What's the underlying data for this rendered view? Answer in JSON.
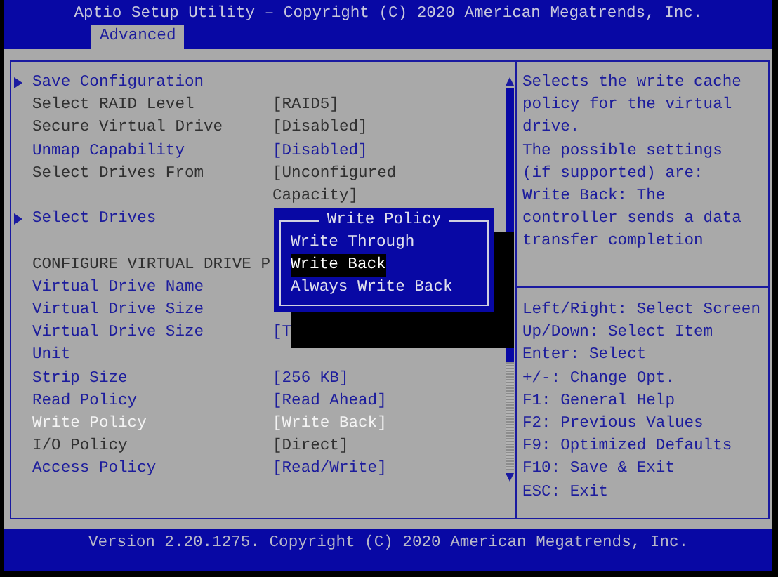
{
  "header": {
    "title": "Aptio Setup Utility – Copyright (C) 2020 American Megatrends, Inc.",
    "tabs": [
      {
        "label": "Advanced",
        "selected": true
      }
    ]
  },
  "settings": [
    {
      "kind": "submenu",
      "label": "Save Configuration",
      "selectable": true,
      "selected": false
    },
    {
      "kind": "setting",
      "label": "Select RAID Level",
      "value": "[RAID5]",
      "selectable": false,
      "selected": false
    },
    {
      "kind": "setting",
      "label": "Secure Virtual Drive",
      "value": "[Disabled]",
      "selectable": false,
      "selected": false
    },
    {
      "kind": "setting",
      "label": "Unmap Capability",
      "value": "[Disabled]",
      "selectable": true,
      "selected": false
    },
    {
      "kind": "setting",
      "label": "Select Drives From",
      "value": "[Unconfigured Capacity]",
      "selectable": false,
      "selected": false
    },
    {
      "kind": "submenu",
      "label": "Select Drives",
      "selectable": true,
      "selected": false
    },
    {
      "kind": "heading",
      "label": "CONFIGURE VIRTUAL DRIVE P"
    },
    {
      "kind": "setting",
      "label": "Virtual Drive Name",
      "selectable": true,
      "selected": false
    },
    {
      "kind": "setting",
      "label": "Virtual Drive Size",
      "selectable": true,
      "selected": false
    },
    {
      "kind": "setting",
      "label": "Virtual Drive Size Unit",
      "value": "[T",
      "selectable": true,
      "selected": false
    },
    {
      "kind": "setting",
      "label": "Strip Size",
      "value": "[256 KB]",
      "selectable": true,
      "selected": false
    },
    {
      "kind": "setting",
      "label": "Read Policy",
      "value": "[Read Ahead]",
      "selectable": true,
      "selected": false
    },
    {
      "kind": "setting",
      "label": "Write Policy",
      "value": "[Write Back]",
      "selectable": true,
      "selected": true
    },
    {
      "kind": "setting",
      "label": "I/O Policy",
      "value": "[Direct]",
      "selectable": false,
      "selected": false
    },
    {
      "kind": "setting",
      "label": "Access Policy",
      "value": "[Read/Write]",
      "selectable": true,
      "selected": false
    }
  ],
  "popup": {
    "title": "Write Policy",
    "options": [
      {
        "label": "Write Through",
        "selected": false
      },
      {
        "label": "Write Back",
        "selected": true
      },
      {
        "label": "Always Write Back",
        "selected": false
      }
    ]
  },
  "help_text": [
    "Selects the write cache",
    "policy for the virtual",
    "drive.",
    "The possible settings",
    "(if supported) are:",
    "Write Back: The",
    "controller sends a data",
    "transfer completion"
  ],
  "key_hints": [
    "Left/Right: Select Screen",
    "Up/Down: Select Item",
    "Enter: Select",
    "+/-: Change Opt.",
    "F1: General Help",
    "F2: Previous Values",
    "F9: Optimized Defaults",
    "F10: Save & Exit",
    "ESC: Exit"
  ],
  "footer": "Version 2.20.1275. Copyright (C) 2020 American Megatrends, Inc."
}
